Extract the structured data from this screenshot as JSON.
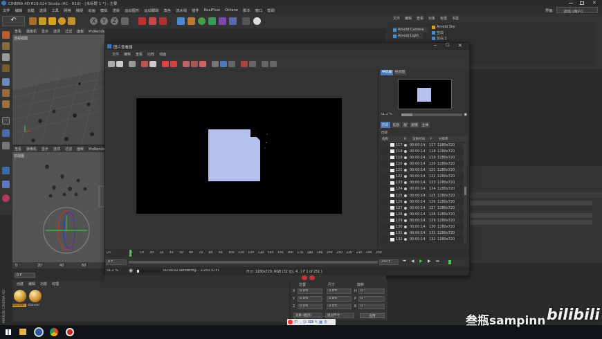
{
  "app_title": "CINEMA 4D R19.024 Studio (RC - R19) - [未标题 1 *] - 主要",
  "menubar": [
    "文件",
    "编辑",
    "创建",
    "选择",
    "工具",
    "网格",
    "捕捉",
    "动画",
    "模拟",
    "渲染",
    "运动图形",
    "运动跟踪",
    "角色",
    "流水线",
    "插件",
    "RealFlow",
    "Octane",
    "脚本",
    "窗口",
    "帮助"
  ],
  "layout_label": "界面:",
  "layout_value": "启动 (用户)",
  "viewport_top": {
    "menu": [
      "查看",
      "摄像机",
      "显示",
      "选项",
      "过滤",
      "面板",
      "ProRender"
    ],
    "label": "透视视图"
  },
  "viewport_bottom": {
    "menu": [
      "查看",
      "摄像机",
      "显示",
      "选项",
      "过滤",
      "面板",
      "ProRender"
    ],
    "label": "前视图"
  },
  "object_manager": {
    "menu": [
      "文件",
      "编辑",
      "查看",
      "对象",
      "标签",
      "书签"
    ],
    "objects": [
      "Arnold Sky",
      "空白",
      "空白.1",
      "Arnold Camera",
      "Arnold Light"
    ]
  },
  "picture_viewer": {
    "title": "图片查看器",
    "menu": [
      "文件",
      "编辑",
      "查看",
      "比较",
      "动画"
    ],
    "nav_tabs": [
      "导航器",
      "柱状图"
    ],
    "zoom": "51.2 %",
    "history_tabs": [
      "历史",
      "信息",
      "层",
      "滤镜",
      "立体"
    ],
    "history_label": "历史",
    "columns": [
      "名称",
      "R",
      "渲染时间",
      "F",
      "分辨率"
    ],
    "rows": [
      [
        "117",
        "00:00:14",
        "117",
        "1280x720"
      ],
      [
        "118",
        "00:00:14",
        "118",
        "1280x720"
      ],
      [
        "119",
        "00:00:14",
        "119",
        "1280x720"
      ],
      [
        "120",
        "00:00:14",
        "120",
        "1280x720"
      ],
      [
        "121",
        "00:00:14",
        "121",
        "1280x720"
      ],
      [
        "122",
        "00:00:14",
        "122",
        "1280x720"
      ],
      [
        "123",
        "00:00:14",
        "123",
        "1280x720"
      ],
      [
        "124",
        "00:00:14",
        "124",
        "1280x720"
      ],
      [
        "125",
        "00:00:14",
        "125",
        "1280x720"
      ],
      [
        "126",
        "00:00:14",
        "126",
        "1280x720"
      ],
      [
        "127",
        "00:00:14",
        "127",
        "1280x720"
      ],
      [
        "128",
        "00:00:14",
        "128",
        "1280x720"
      ],
      [
        "129",
        "00:00:14",
        "129",
        "1280x720"
      ],
      [
        "130",
        "00:00:14",
        "130",
        "1280x720"
      ],
      [
        "131",
        "00:00:14",
        "131",
        "1280x720"
      ],
      [
        "132",
        "00:00:14",
        "132",
        "1280x720"
      ]
    ],
    "timeline_ticks": [
      "0",
      "10",
      "20",
      "30",
      "40",
      "50",
      "60",
      "70",
      "80",
      "90",
      "100",
      "110",
      "120",
      "130",
      "140",
      "150",
      "160",
      "170",
      "180",
      "190",
      "200",
      "210",
      "220",
      "230",
      "240",
      "250"
    ],
    "frame_start": "0 F",
    "frame_current": "0 F",
    "frame_end": "250 F",
    "status_zoom": "51.2 %",
    "status_render": "00:00:02 Rendering... 1/251 (0 F)",
    "status_size": "尺寸: 1280x720, RGB (32 位), 4.. ( F 1 of 251 )"
  },
  "timeline_main": {
    "ticks": [
      "0",
      "20",
      "40",
      "60"
    ],
    "frame": "0 F"
  },
  "material_manager": {
    "menu": [
      "创建",
      "编辑",
      "功能",
      "纹理"
    ],
    "materials": [
      "standar",
      "standar"
    ]
  },
  "coordinates": {
    "headers": [
      "位置",
      "尺寸",
      "旋转"
    ],
    "rows": [
      {
        "axis": "X",
        "pos": "0 cm",
        "size": "0 cm",
        "rot_label": "H",
        "rot": "0 °"
      },
      {
        "axis": "Y",
        "pos": "0 cm",
        "size": "0 cm",
        "rot_label": "P",
        "rot": "0 °"
      },
      {
        "axis": "Z",
        "pos": "0 cm",
        "size": "0 cm",
        "rot_label": "B",
        "rot": "0 °"
      }
    ],
    "mode": "对象 (相对)",
    "size_mode": "绝对尺寸",
    "apply": "应用"
  },
  "maxon_label": "MAXON CINEMA 4D",
  "watermark": "叁瓶sampinn",
  "bilibili": "bilibili",
  "colors": {
    "bg": "#2b2b2b",
    "panel": "#333333",
    "accent": "#4a7ab8",
    "render_box": "#b5c0ef"
  }
}
